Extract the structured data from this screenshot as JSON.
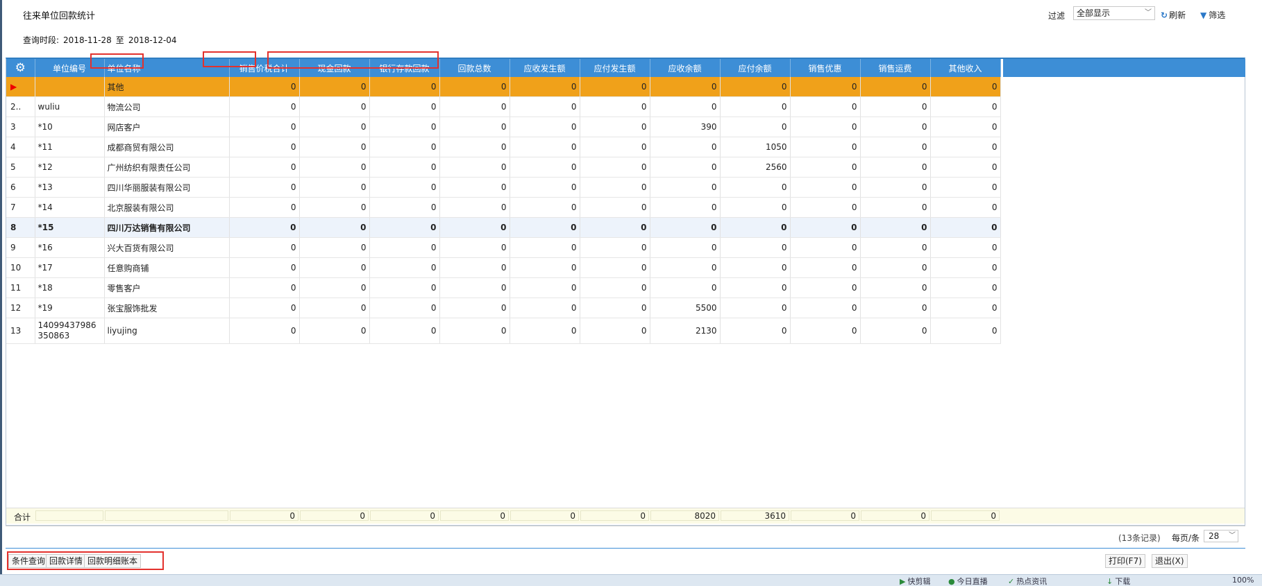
{
  "title": "往来单位回款统计",
  "period": {
    "label": "查询时段:",
    "start": "2018-11-28",
    "sep": "至",
    "end": "2018-12-04"
  },
  "filter": {
    "label": "过滤",
    "value": "全部显示",
    "refresh": "刷新",
    "screen": "筛选"
  },
  "columns": [
    "单位编号",
    "单位名称",
    "销售价税合计",
    "现金回款",
    "银行存款回款",
    "回款总数",
    "应收发生额",
    "应付发生额",
    "应收余额",
    "应付余额",
    "销售优惠",
    "销售运费",
    "其他收入"
  ],
  "rows": [
    {
      "no": "▶",
      "code": "",
      "name": "其他",
      "v": [
        "0",
        "0",
        "0",
        "0",
        "0",
        "0",
        "0",
        "0",
        "0",
        "0",
        "0"
      ]
    },
    {
      "no": "2..",
      "code": "wuliu",
      "name": "物流公司",
      "v": [
        "0",
        "0",
        "0",
        "0",
        "0",
        "0",
        "0",
        "0",
        "0",
        "0",
        "0"
      ]
    },
    {
      "no": "3",
      "code": "*10",
      "name": "网店客户",
      "v": [
        "0",
        "0",
        "0",
        "0",
        "0",
        "0",
        "390",
        "0",
        "0",
        "0",
        "0"
      ]
    },
    {
      "no": "4",
      "code": "*11",
      "name": "成都商贸有限公司",
      "v": [
        "0",
        "0",
        "0",
        "0",
        "0",
        "0",
        "0",
        "1050",
        "0",
        "0",
        "0"
      ]
    },
    {
      "no": "5",
      "code": "*12",
      "name": "广州纺织有限责任公司",
      "v": [
        "0",
        "0",
        "0",
        "0",
        "0",
        "0",
        "0",
        "2560",
        "0",
        "0",
        "0"
      ]
    },
    {
      "no": "6",
      "code": "*13",
      "name": "四川华丽服装有限公司",
      "v": [
        "0",
        "0",
        "0",
        "0",
        "0",
        "0",
        "0",
        "0",
        "0",
        "0",
        "0"
      ]
    },
    {
      "no": "7",
      "code": "*14",
      "name": "北京服装有限公司",
      "v": [
        "0",
        "0",
        "0",
        "0",
        "0",
        "0",
        "0",
        "0",
        "0",
        "0",
        "0"
      ]
    },
    {
      "no": "8",
      "code": "*15",
      "name": "四川万达销售有限公司",
      "v": [
        "0",
        "0",
        "0",
        "0",
        "0",
        "0",
        "0",
        "0",
        "0",
        "0",
        "0"
      ]
    },
    {
      "no": "9",
      "code": "*16",
      "name": "兴大百货有限公司",
      "v": [
        "0",
        "0",
        "0",
        "0",
        "0",
        "0",
        "0",
        "0",
        "0",
        "0",
        "0"
      ]
    },
    {
      "no": "10",
      "code": "*17",
      "name": "任意购商铺",
      "v": [
        "0",
        "0",
        "0",
        "0",
        "0",
        "0",
        "0",
        "0",
        "0",
        "0",
        "0"
      ]
    },
    {
      "no": "11",
      "code": "*18",
      "name": "零售客户",
      "v": [
        "0",
        "0",
        "0",
        "0",
        "0",
        "0",
        "0",
        "0",
        "0",
        "0",
        "0"
      ]
    },
    {
      "no": "12",
      "code": "*19",
      "name": "张宝服饰批发",
      "v": [
        "0",
        "0",
        "0",
        "0",
        "0",
        "0",
        "5500",
        "0",
        "0",
        "0",
        "0"
      ]
    },
    {
      "no": "13",
      "code": "14099437986350863",
      "name": "liyujing",
      "v": [
        "0",
        "0",
        "0",
        "0",
        "0",
        "0",
        "2130",
        "0",
        "0",
        "0",
        "0"
      ]
    }
  ],
  "totals": {
    "label": "合计",
    "v": [
      "0",
      "0",
      "0",
      "0",
      "0",
      "0",
      "8020",
      "3610",
      "0",
      "0",
      "0"
    ]
  },
  "pager": {
    "records": "(13条记录)",
    "per_page": "每页/条",
    "size": "28"
  },
  "buttons": {
    "query": "条件查询",
    "detail": "回款详情",
    "ledger": "回款明细账本",
    "print": "打印(F7)",
    "exit": "退出(X)"
  },
  "status": {
    "a": "快剪辑",
    "b": "今日直播",
    "c": "热点资讯",
    "d": "下载",
    "e": "100%"
  },
  "colors": {
    "header": "#3d8ed6",
    "current_row": "#f0a11a",
    "highlight_box": "#e3312d"
  },
  "icons": {
    "settings": "gear-icon",
    "refresh": "refresh-icon",
    "filter": "funnel-icon",
    "current": "row-pointer-icon"
  }
}
